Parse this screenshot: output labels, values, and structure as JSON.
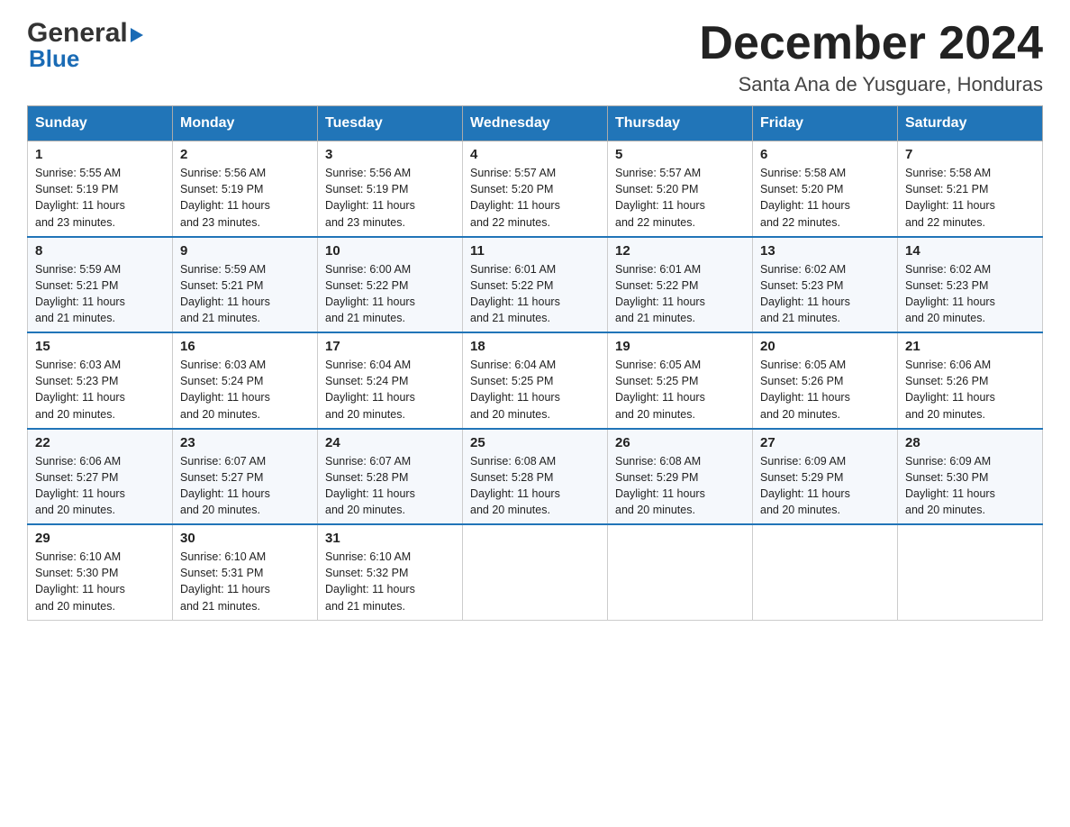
{
  "logo": {
    "line1": "General",
    "arrow": "▶",
    "line2": "Blue"
  },
  "title": "December 2024",
  "subtitle": "Santa Ana de Yusguare, Honduras",
  "days_of_week": [
    "Sunday",
    "Monday",
    "Tuesday",
    "Wednesday",
    "Thursday",
    "Friday",
    "Saturday"
  ],
  "weeks": [
    [
      {
        "day": "1",
        "sunrise": "5:55 AM",
        "sunset": "5:19 PM",
        "daylight": "11 hours and 23 minutes."
      },
      {
        "day": "2",
        "sunrise": "5:56 AM",
        "sunset": "5:19 PM",
        "daylight": "11 hours and 23 minutes."
      },
      {
        "day": "3",
        "sunrise": "5:56 AM",
        "sunset": "5:19 PM",
        "daylight": "11 hours and 23 minutes."
      },
      {
        "day": "4",
        "sunrise": "5:57 AM",
        "sunset": "5:20 PM",
        "daylight": "11 hours and 22 minutes."
      },
      {
        "day": "5",
        "sunrise": "5:57 AM",
        "sunset": "5:20 PM",
        "daylight": "11 hours and 22 minutes."
      },
      {
        "day": "6",
        "sunrise": "5:58 AM",
        "sunset": "5:20 PM",
        "daylight": "11 hours and 22 minutes."
      },
      {
        "day": "7",
        "sunrise": "5:58 AM",
        "sunset": "5:21 PM",
        "daylight": "11 hours and 22 minutes."
      }
    ],
    [
      {
        "day": "8",
        "sunrise": "5:59 AM",
        "sunset": "5:21 PM",
        "daylight": "11 hours and 21 minutes."
      },
      {
        "day": "9",
        "sunrise": "5:59 AM",
        "sunset": "5:21 PM",
        "daylight": "11 hours and 21 minutes."
      },
      {
        "day": "10",
        "sunrise": "6:00 AM",
        "sunset": "5:22 PM",
        "daylight": "11 hours and 21 minutes."
      },
      {
        "day": "11",
        "sunrise": "6:01 AM",
        "sunset": "5:22 PM",
        "daylight": "11 hours and 21 minutes."
      },
      {
        "day": "12",
        "sunrise": "6:01 AM",
        "sunset": "5:22 PM",
        "daylight": "11 hours and 21 minutes."
      },
      {
        "day": "13",
        "sunrise": "6:02 AM",
        "sunset": "5:23 PM",
        "daylight": "11 hours and 21 minutes."
      },
      {
        "day": "14",
        "sunrise": "6:02 AM",
        "sunset": "5:23 PM",
        "daylight": "11 hours and 20 minutes."
      }
    ],
    [
      {
        "day": "15",
        "sunrise": "6:03 AM",
        "sunset": "5:23 PM",
        "daylight": "11 hours and 20 minutes."
      },
      {
        "day": "16",
        "sunrise": "6:03 AM",
        "sunset": "5:24 PM",
        "daylight": "11 hours and 20 minutes."
      },
      {
        "day": "17",
        "sunrise": "6:04 AM",
        "sunset": "5:24 PM",
        "daylight": "11 hours and 20 minutes."
      },
      {
        "day": "18",
        "sunrise": "6:04 AM",
        "sunset": "5:25 PM",
        "daylight": "11 hours and 20 minutes."
      },
      {
        "day": "19",
        "sunrise": "6:05 AM",
        "sunset": "5:25 PM",
        "daylight": "11 hours and 20 minutes."
      },
      {
        "day": "20",
        "sunrise": "6:05 AM",
        "sunset": "5:26 PM",
        "daylight": "11 hours and 20 minutes."
      },
      {
        "day": "21",
        "sunrise": "6:06 AM",
        "sunset": "5:26 PM",
        "daylight": "11 hours and 20 minutes."
      }
    ],
    [
      {
        "day": "22",
        "sunrise": "6:06 AM",
        "sunset": "5:27 PM",
        "daylight": "11 hours and 20 minutes."
      },
      {
        "day": "23",
        "sunrise": "6:07 AM",
        "sunset": "5:27 PM",
        "daylight": "11 hours and 20 minutes."
      },
      {
        "day": "24",
        "sunrise": "6:07 AM",
        "sunset": "5:28 PM",
        "daylight": "11 hours and 20 minutes."
      },
      {
        "day": "25",
        "sunrise": "6:08 AM",
        "sunset": "5:28 PM",
        "daylight": "11 hours and 20 minutes."
      },
      {
        "day": "26",
        "sunrise": "6:08 AM",
        "sunset": "5:29 PM",
        "daylight": "11 hours and 20 minutes."
      },
      {
        "day": "27",
        "sunrise": "6:09 AM",
        "sunset": "5:29 PM",
        "daylight": "11 hours and 20 minutes."
      },
      {
        "day": "28",
        "sunrise": "6:09 AM",
        "sunset": "5:30 PM",
        "daylight": "11 hours and 20 minutes."
      }
    ],
    [
      {
        "day": "29",
        "sunrise": "6:10 AM",
        "sunset": "5:30 PM",
        "daylight": "11 hours and 20 minutes."
      },
      {
        "day": "30",
        "sunrise": "6:10 AM",
        "sunset": "5:31 PM",
        "daylight": "11 hours and 21 minutes."
      },
      {
        "day": "31",
        "sunrise": "6:10 AM",
        "sunset": "5:32 PM",
        "daylight": "11 hours and 21 minutes."
      },
      null,
      null,
      null,
      null
    ]
  ],
  "labels": {
    "sunrise": "Sunrise:",
    "sunset": "Sunset:",
    "daylight": "Daylight:"
  }
}
